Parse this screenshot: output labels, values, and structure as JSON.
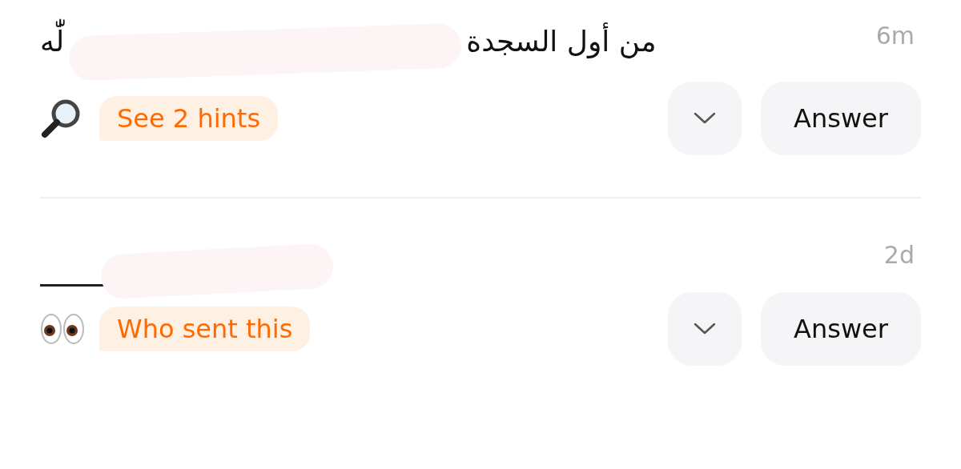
{
  "messages": [
    {
      "text": "من أول السجدة",
      "text_tail": "لّٰه",
      "time": "6m",
      "redacted": true,
      "hint": {
        "kind": "search",
        "label": "See 2 hints"
      },
      "answer": "Answer"
    },
    {
      "time": "2d",
      "redacted": true,
      "hint": {
        "kind": "eyes",
        "label": "Who sent this"
      },
      "answer": "Answer"
    }
  ]
}
